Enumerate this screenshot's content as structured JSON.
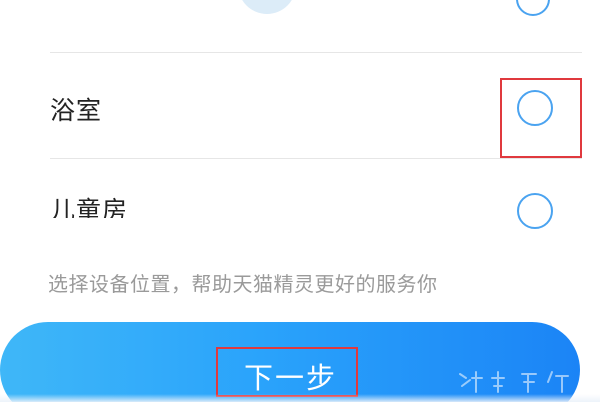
{
  "rooms": [
    {
      "label": ""
    },
    {
      "label": "浴室"
    },
    {
      "label": "儿童房"
    }
  ],
  "hint": "选择设备位置，帮助天猫精灵更好的服务你",
  "next_button": {
    "label": "下一步"
  },
  "colors": {
    "radio_border": "#4aa3f0",
    "button_start": "#3fb7f8",
    "button_end": "#1b84f6",
    "highlight": "#e0393e",
    "hint_text": "#9a9a9a"
  }
}
